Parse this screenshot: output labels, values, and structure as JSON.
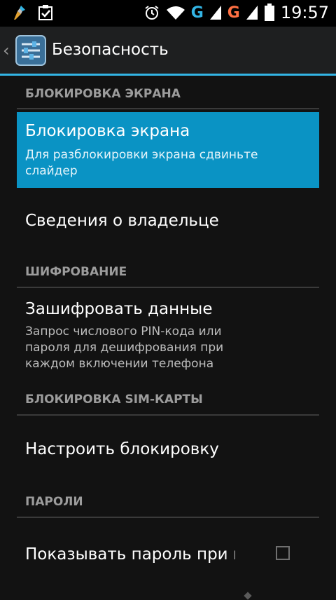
{
  "status_bar": {
    "time": "19:57",
    "icons": [
      "broom-icon",
      "clipboard-check-icon",
      "alarm-icon",
      "wifi-icon",
      "signal-g-icon",
      "signal-g-icon",
      "battery-icon"
    ],
    "network_label_1": "G",
    "network_label_2": "G",
    "network_color_1": "#33b5e5",
    "network_color_2": "#ff7043"
  },
  "action_bar": {
    "title": "Безопасность",
    "accent_color": "#33b5e5"
  },
  "sections": [
    {
      "header": "БЛОКИРОВКА ЭКРАНА",
      "items": [
        {
          "title": "Блокировка экрана",
          "summary": "Для разблокировки экрана сдвиньте слайдер",
          "selected": true
        },
        {
          "title": "Сведения о владельце"
        }
      ]
    },
    {
      "header": "ШИФРОВАНИЕ",
      "items": [
        {
          "title": "Зашифровать данные",
          "summary": "Запрос числового PIN-кода или пароля для дешифрования при каждом включении телефона"
        }
      ]
    },
    {
      "header": "БЛОКИРОВКА SIM-КАРТЫ",
      "items": [
        {
          "title": "Настроить блокировку"
        }
      ]
    },
    {
      "header": "ПАРОЛИ",
      "items": [
        {
          "title": "Показывать пароль при в",
          "checked": false
        }
      ]
    }
  ],
  "colors": {
    "highlight": "#0a93c4",
    "background": "#121212",
    "section_header": "#9c9c9c"
  }
}
